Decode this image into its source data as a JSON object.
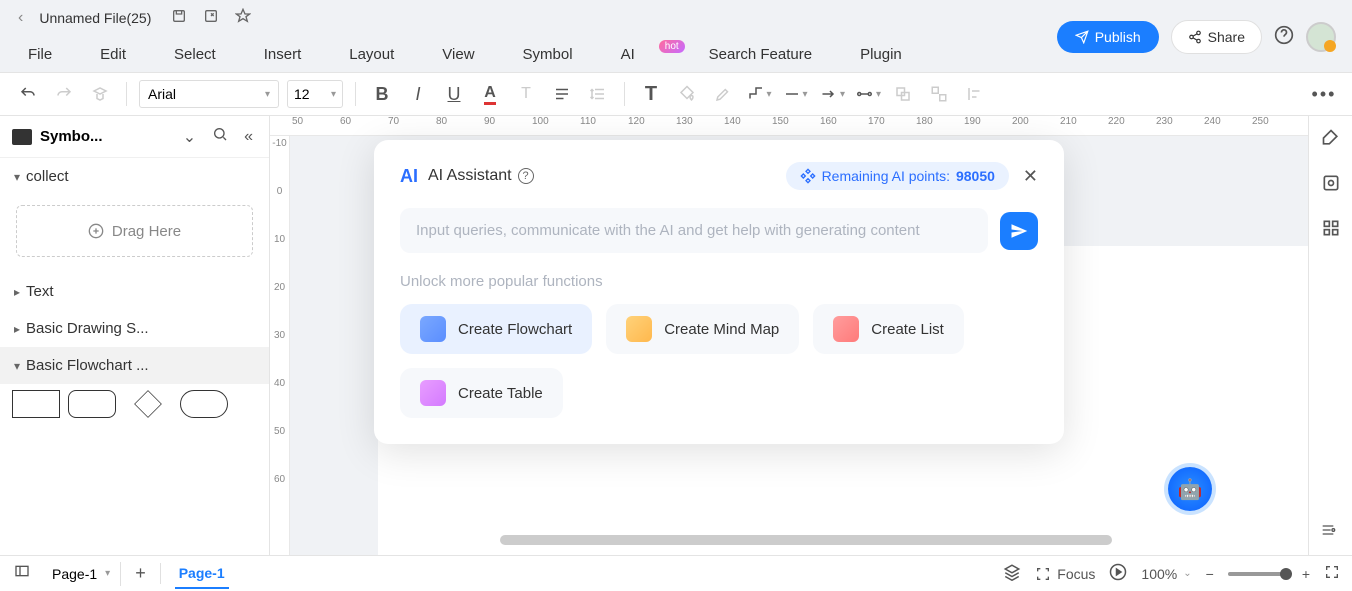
{
  "titlebar": {
    "filename": "Unnamed File(25)"
  },
  "topright": {
    "publish": "Publish",
    "share": "Share"
  },
  "menu": {
    "file": "File",
    "edit": "Edit",
    "select": "Select",
    "insert": "Insert",
    "layout": "Layout",
    "view": "View",
    "symbol": "Symbol",
    "ai": "AI",
    "ai_badge": "hot",
    "search": "Search Feature",
    "plugin": "Plugin"
  },
  "toolbar": {
    "font": "Arial",
    "size": "12"
  },
  "sidebar": {
    "title": "Symbo...",
    "sections": {
      "collect": "collect",
      "drag": "Drag Here",
      "text": "Text",
      "basic_drawing": "Basic Drawing S...",
      "basic_flowchart": "Basic Flowchart ..."
    }
  },
  "ruler_h": [
    "50",
    "60",
    "70",
    "80",
    "90",
    "100",
    "110",
    "120",
    "130",
    "140",
    "150",
    "160",
    "170",
    "180",
    "190",
    "200",
    "210",
    "220",
    "230",
    "240",
    "250"
  ],
  "ruler_v": [
    "-10",
    "0",
    "10",
    "20",
    "30",
    "40",
    "50",
    "60"
  ],
  "ai": {
    "title": "AI Assistant",
    "points_label": "Remaining AI points:",
    "points_value": "98050",
    "placeholder": "Input queries, communicate with the AI and get help with generating content",
    "unlock": "Unlock more popular functions",
    "cards": {
      "flowchart": "Create Flowchart",
      "mindmap": "Create Mind Map",
      "list": "Create List",
      "table": "Create Table"
    }
  },
  "status": {
    "page_sel": "Page-1",
    "page_tab": "Page-1",
    "focus": "Focus",
    "zoom": "100%"
  }
}
